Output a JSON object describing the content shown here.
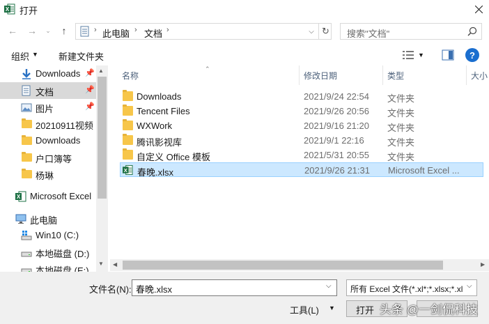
{
  "window": {
    "title": "打开"
  },
  "nav": {
    "address_crumbs": [
      "此电脑",
      "文档"
    ],
    "search_placeholder": "搜索\"文档\""
  },
  "toolbar": {
    "organize_label": "组织",
    "new_folder_label": "新建文件夹"
  },
  "sidebar": {
    "items": [
      {
        "label": "Downloads",
        "icon": "download-arrow-icon",
        "pinned": true
      },
      {
        "label": "文档",
        "icon": "document-icon",
        "pinned": true,
        "selected": true
      },
      {
        "label": "图片",
        "icon": "pictures-icon",
        "pinned": true
      },
      {
        "label": "20210911视频",
        "icon": "folder-icon"
      },
      {
        "label": "Downloads",
        "icon": "folder-icon"
      },
      {
        "label": "户口簿等",
        "icon": "folder-icon"
      },
      {
        "label": "杨琳",
        "icon": "folder-icon"
      },
      {
        "label": "Microsoft Excel",
        "icon": "excel-icon"
      },
      {
        "label": "此电脑",
        "icon": "computer-icon"
      },
      {
        "label": "Win10 (C:)",
        "icon": "windows-drive-icon"
      },
      {
        "label": "本地磁盘 (D:)",
        "icon": "drive-icon"
      },
      {
        "label": "本地磁盘 (E:)",
        "icon": "drive-icon"
      }
    ]
  },
  "filelist": {
    "columns": [
      "名称",
      "修改日期",
      "类型",
      "大小"
    ],
    "rows": [
      {
        "name": "Downloads",
        "date": "2021/9/24 22:54",
        "type": "文件夹",
        "icon": "folder-icon"
      },
      {
        "name": "Tencent Files",
        "date": "2021/9/26 20:56",
        "type": "文件夹",
        "icon": "folder-icon"
      },
      {
        "name": "WXWork",
        "date": "2021/9/16 21:20",
        "type": "文件夹",
        "icon": "folder-icon"
      },
      {
        "name": "腾讯影视库",
        "date": "2021/9/1 22:16",
        "type": "文件夹",
        "icon": "folder-icon"
      },
      {
        "name": "自定义 Office 模板",
        "date": "2021/5/31 20:55",
        "type": "文件夹",
        "icon": "folder-icon"
      },
      {
        "name": "春晚.xlsx",
        "date": "2021/9/26 21:31",
        "type": "Microsoft Excel ...",
        "icon": "excel-icon",
        "selected": true
      }
    ]
  },
  "bottom": {
    "filename_label": "文件名(N):",
    "filename_value": "春晚.xlsx",
    "filter_value": "所有 Excel 文件(*.xl*;*.xlsx;*.xl",
    "tools_label": "工具(L)",
    "open_label": "打开",
    "cancel_label": ""
  },
  "watermark": "头条 @一剑侃科技",
  "colors": {
    "accent": "#1a6ecf",
    "selection": "#cce8ff",
    "excel_green": "#1d7044",
    "folder": "#f7c64a"
  }
}
